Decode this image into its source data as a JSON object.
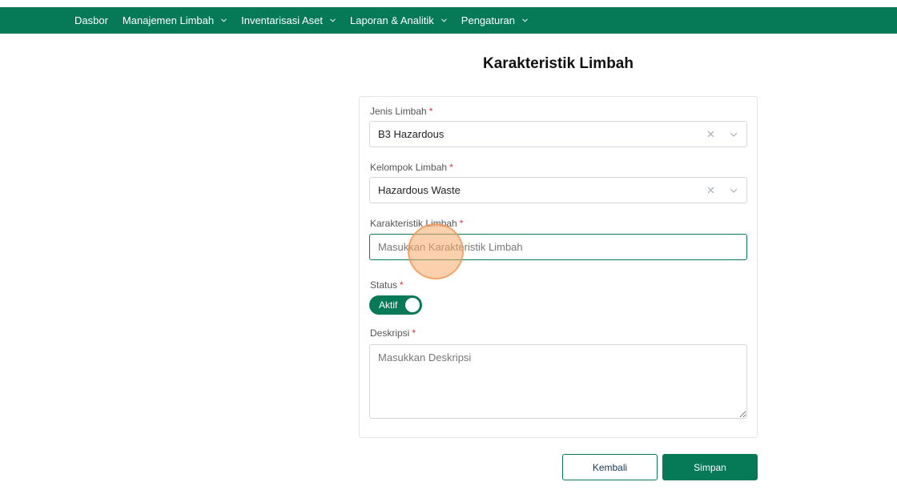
{
  "nav": {
    "items": [
      {
        "label": "Dasbor",
        "has_dropdown": false
      },
      {
        "label": "Manajemen Limbah",
        "has_dropdown": true
      },
      {
        "label": "Inventarisasi Aset",
        "has_dropdown": true
      },
      {
        "label": "Laporan & Analitik",
        "has_dropdown": true
      },
      {
        "label": "Pengaturan",
        "has_dropdown": true
      }
    ],
    "icon": "chevron-down-icon"
  },
  "page": {
    "title": "Karakteristik Limbah"
  },
  "form": {
    "required_mark": "*",
    "jenis_limbah": {
      "label": "Jenis Limbah",
      "value": "B3 Hazardous"
    },
    "kelompok_limbah": {
      "label": "Kelompok Limbah",
      "value": "Hazardous Waste"
    },
    "karakteristik_limbah": {
      "label": "Karakteristik Limbah",
      "value": "",
      "placeholder": "Masukkan Karakteristik Limbah"
    },
    "status": {
      "label": "Status",
      "toggle_label": "Aktif",
      "on": true
    },
    "deskripsi": {
      "label": "Deskripsi",
      "value": "",
      "placeholder": "Masukkan Deskripsi"
    }
  },
  "buttons": {
    "back": "Kembali",
    "save": "Simpan"
  },
  "colors": {
    "primary": "#067a57",
    "required": "#d9363e",
    "cursor_highlight": "#f7aa69"
  }
}
